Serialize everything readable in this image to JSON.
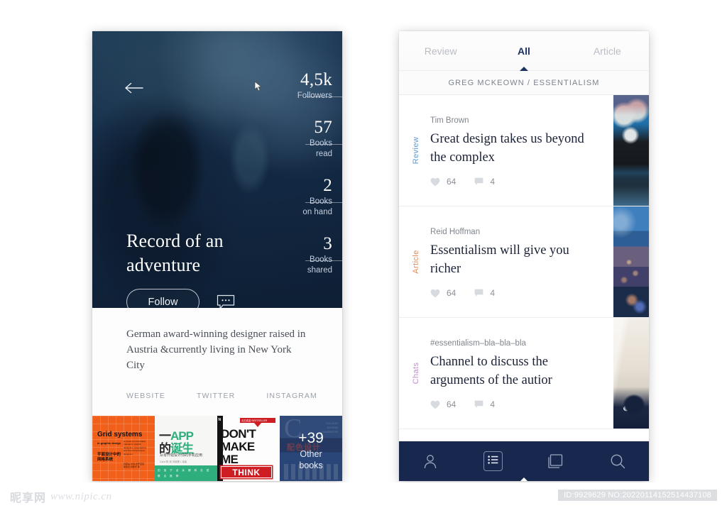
{
  "left_phone": {
    "back_icon": "back-arrow-icon",
    "stats": [
      {
        "value": "4,5k",
        "label": "Followers",
        "rule_width": 52
      },
      {
        "value": "57",
        "label": "Books\nread",
        "rule_width": 52
      },
      {
        "value": "2",
        "label": "Books\non hand",
        "rule_width": 52
      },
      {
        "value": "3",
        "label": "Books\nshared",
        "rule_width": 52
      }
    ],
    "title": "Record of an adventure",
    "follow_label": "Follow",
    "message_icon": "chat-bubble-icon",
    "bio": "German award-winning designer raised in Austria &currently living in New York City",
    "social_links": [
      "WEBSITE",
      "TWITTER",
      "INSTAGRAM"
    ],
    "books": {
      "book1": {
        "title": "Grid systems",
        "subtitle": "in graphic design",
        "cn_line1": "平面设计中的",
        "cn_line2": "网格系统",
        "blurb": "A visual communication manual for graphic designers, typographers and three dimensional designers",
        "blurb2": "作者：约瑟夫·米勒-布罗克曼\n译者：徐宸熹 张鹏宇"
      },
      "book2": {
        "head_num": "一",
        "head_app": "APP",
        "head_de": "的",
        "head_birth": "诞生",
        "sub": "从零开始设计你的手机应用",
        "credit": "Carol 陈 张 刘晓蕾丨译者",
        "band1": "田 宝 子    龙 兵 娜    林 志 斌",
        "band2": "联 合 推 荐"
      },
      "book3": {
        "spine": "N",
        "ribbon": "点石成金 BESTSELLER",
        "line1": "DON'T",
        "line2": "MAKE",
        "line3": "ME",
        "line4": "THINK"
      },
      "book4": {
        "bigletter": "C",
        "cn": "配色设计",
        "small": "COLOUR\nDESIGN\nHANDBOOK",
        "plus": "+39",
        "other": "Other",
        "books": "books"
      }
    }
  },
  "right_phone": {
    "tabs": [
      {
        "label": "Review",
        "active": false
      },
      {
        "label": "All",
        "active": true
      },
      {
        "label": "Article",
        "active": false
      }
    ],
    "book_header": "GREG MCKEOWN / ESSENTIALISM",
    "cards": [
      {
        "side_label": "Review",
        "side_color": "#5b9bd5",
        "author": "Tim Brown",
        "title": "Great design takes us beyond the complex",
        "likes": "64",
        "comments": "4",
        "thumb": "bottle-caps-photo"
      },
      {
        "side_label": "Article",
        "side_color": "#e08a5a",
        "author": "Reid Hoffman",
        "title": "Essentialism will give you richer",
        "likes": "64",
        "comments": "4",
        "thumb": "city-skyline-photo"
      },
      {
        "side_label": "Chats",
        "side_color": "#c48fd1",
        "author": "#essentialism–bla–bla–bla",
        "title": "Channel to discuss the arguments of the autior",
        "likes": "64",
        "comments": "4",
        "thumb": "interior-photo"
      }
    ],
    "bottom_nav": [
      {
        "icon": "person-icon",
        "active": false
      },
      {
        "icon": "list-icon",
        "active": true
      },
      {
        "icon": "cards-stack-icon",
        "active": false
      },
      {
        "icon": "search-icon",
        "active": false
      }
    ]
  },
  "footer": {
    "logo_cn": "昵享网",
    "logo_url": "www.nipic.cn",
    "id_text": "ID:9929629 NO:20220114152514437108"
  },
  "colors": {
    "navy": "#17274e",
    "tab_active": "#1c3360",
    "review": "#5b9bd5",
    "article": "#e08a5a",
    "chats": "#c48fd1",
    "orange_book": "#f0601b"
  }
}
